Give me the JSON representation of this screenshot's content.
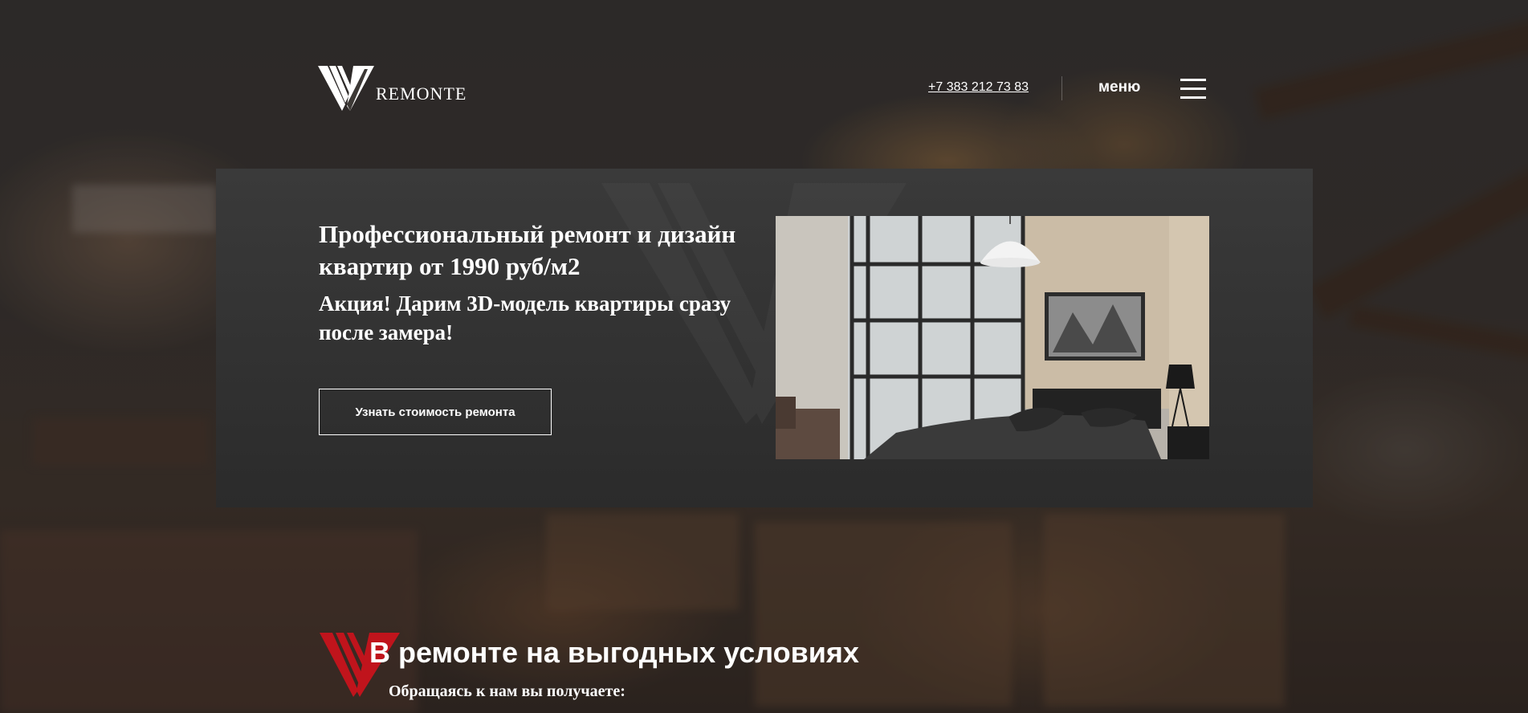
{
  "header": {
    "logo_text": "REMONTE",
    "phone": "+7 383 212 73 83",
    "menu_label": "меню"
  },
  "hero": {
    "title": "Профессиональный ремонт и дизайн квартир от 1990 руб/м2",
    "subtitle": "Акция! Дарим 3D-модель квартиры сразу после замера!",
    "cta_label": "Узнать стоимость ремонта"
  },
  "section": {
    "title": "В ремонте на выгодных условиях",
    "subtitle": "Обращаясь к нам вы получаете:"
  },
  "colors": {
    "panel": "#2f2f2f",
    "accent": "#c0141c",
    "text": "#ffffff"
  },
  "icons": [
    "logo-v-icon",
    "burger-menu-icon",
    "section-logo-icon"
  ]
}
